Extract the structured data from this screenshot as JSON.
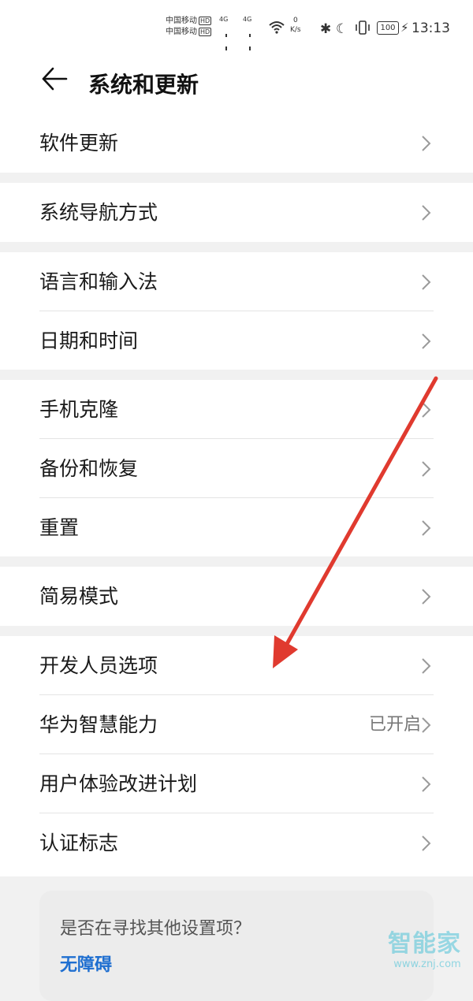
{
  "status_bar": {
    "carrier_1": "中国移动",
    "carrier_2": "中国移动",
    "hd": "HD",
    "net_1": "4G",
    "net_2": "4G",
    "speed_value": "0",
    "speed_unit": "K/s",
    "battery": "100",
    "time": "13:13"
  },
  "header": {
    "title": "系统和更新"
  },
  "groups": [
    {
      "items": [
        {
          "label": "软件更新"
        }
      ]
    },
    {
      "items": [
        {
          "label": "系统导航方式"
        }
      ]
    },
    {
      "items": [
        {
          "label": "语言和输入法"
        },
        {
          "label": "日期和时间"
        }
      ]
    },
    {
      "items": [
        {
          "label": "手机克隆"
        },
        {
          "label": "备份和恢复"
        },
        {
          "label": "重置"
        }
      ]
    },
    {
      "items": [
        {
          "label": "简易模式"
        }
      ]
    },
    {
      "items": [
        {
          "label": "开发人员选项"
        },
        {
          "label": "华为智慧能力",
          "value": "已开启"
        },
        {
          "label": "用户体验改进计划"
        },
        {
          "label": "认证标志"
        }
      ]
    }
  ],
  "suggestion": {
    "question": "是否在寻找其他设置项？",
    "link": "无障碍"
  },
  "watermark": {
    "brand": "智能家",
    "url": "www.znj.com"
  },
  "colors": {
    "annotation_arrow": "#e03a2f",
    "link": "#1f6fd0"
  }
}
